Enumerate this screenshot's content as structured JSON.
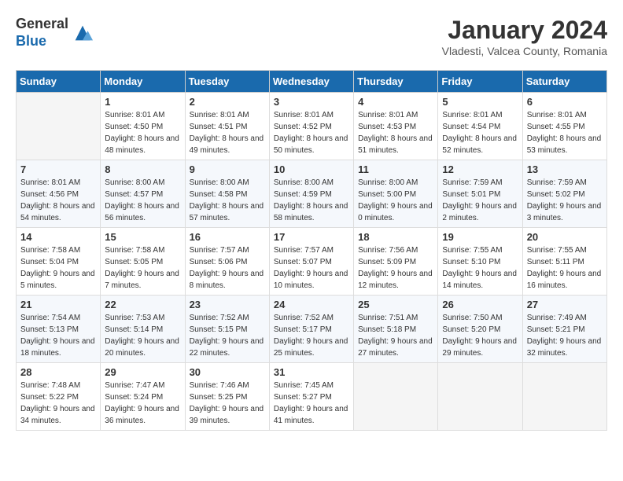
{
  "logo": {
    "general": "General",
    "blue": "Blue"
  },
  "title": "January 2024",
  "location": "Vladesti, Valcea County, Romania",
  "days_of_week": [
    "Sunday",
    "Monday",
    "Tuesday",
    "Wednesday",
    "Thursday",
    "Friday",
    "Saturday"
  ],
  "weeks": [
    [
      {
        "day": "",
        "sunrise": "",
        "sunset": "",
        "daylight": ""
      },
      {
        "day": "1",
        "sunrise": "Sunrise: 8:01 AM",
        "sunset": "Sunset: 4:50 PM",
        "daylight": "Daylight: 8 hours and 48 minutes."
      },
      {
        "day": "2",
        "sunrise": "Sunrise: 8:01 AM",
        "sunset": "Sunset: 4:51 PM",
        "daylight": "Daylight: 8 hours and 49 minutes."
      },
      {
        "day": "3",
        "sunrise": "Sunrise: 8:01 AM",
        "sunset": "Sunset: 4:52 PM",
        "daylight": "Daylight: 8 hours and 50 minutes."
      },
      {
        "day": "4",
        "sunrise": "Sunrise: 8:01 AM",
        "sunset": "Sunset: 4:53 PM",
        "daylight": "Daylight: 8 hours and 51 minutes."
      },
      {
        "day": "5",
        "sunrise": "Sunrise: 8:01 AM",
        "sunset": "Sunset: 4:54 PM",
        "daylight": "Daylight: 8 hours and 52 minutes."
      },
      {
        "day": "6",
        "sunrise": "Sunrise: 8:01 AM",
        "sunset": "Sunset: 4:55 PM",
        "daylight": "Daylight: 8 hours and 53 minutes."
      }
    ],
    [
      {
        "day": "7",
        "sunrise": "Sunrise: 8:01 AM",
        "sunset": "Sunset: 4:56 PM",
        "daylight": "Daylight: 8 hours and 54 minutes."
      },
      {
        "day": "8",
        "sunrise": "Sunrise: 8:00 AM",
        "sunset": "Sunset: 4:57 PM",
        "daylight": "Daylight: 8 hours and 56 minutes."
      },
      {
        "day": "9",
        "sunrise": "Sunrise: 8:00 AM",
        "sunset": "Sunset: 4:58 PM",
        "daylight": "Daylight: 8 hours and 57 minutes."
      },
      {
        "day": "10",
        "sunrise": "Sunrise: 8:00 AM",
        "sunset": "Sunset: 4:59 PM",
        "daylight": "Daylight: 8 hours and 58 minutes."
      },
      {
        "day": "11",
        "sunrise": "Sunrise: 8:00 AM",
        "sunset": "Sunset: 5:00 PM",
        "daylight": "Daylight: 9 hours and 0 minutes."
      },
      {
        "day": "12",
        "sunrise": "Sunrise: 7:59 AM",
        "sunset": "Sunset: 5:01 PM",
        "daylight": "Daylight: 9 hours and 2 minutes."
      },
      {
        "day": "13",
        "sunrise": "Sunrise: 7:59 AM",
        "sunset": "Sunset: 5:02 PM",
        "daylight": "Daylight: 9 hours and 3 minutes."
      }
    ],
    [
      {
        "day": "14",
        "sunrise": "Sunrise: 7:58 AM",
        "sunset": "Sunset: 5:04 PM",
        "daylight": "Daylight: 9 hours and 5 minutes."
      },
      {
        "day": "15",
        "sunrise": "Sunrise: 7:58 AM",
        "sunset": "Sunset: 5:05 PM",
        "daylight": "Daylight: 9 hours and 7 minutes."
      },
      {
        "day": "16",
        "sunrise": "Sunrise: 7:57 AM",
        "sunset": "Sunset: 5:06 PM",
        "daylight": "Daylight: 9 hours and 8 minutes."
      },
      {
        "day": "17",
        "sunrise": "Sunrise: 7:57 AM",
        "sunset": "Sunset: 5:07 PM",
        "daylight": "Daylight: 9 hours and 10 minutes."
      },
      {
        "day": "18",
        "sunrise": "Sunrise: 7:56 AM",
        "sunset": "Sunset: 5:09 PM",
        "daylight": "Daylight: 9 hours and 12 minutes."
      },
      {
        "day": "19",
        "sunrise": "Sunrise: 7:55 AM",
        "sunset": "Sunset: 5:10 PM",
        "daylight": "Daylight: 9 hours and 14 minutes."
      },
      {
        "day": "20",
        "sunrise": "Sunrise: 7:55 AM",
        "sunset": "Sunset: 5:11 PM",
        "daylight": "Daylight: 9 hours and 16 minutes."
      }
    ],
    [
      {
        "day": "21",
        "sunrise": "Sunrise: 7:54 AM",
        "sunset": "Sunset: 5:13 PM",
        "daylight": "Daylight: 9 hours and 18 minutes."
      },
      {
        "day": "22",
        "sunrise": "Sunrise: 7:53 AM",
        "sunset": "Sunset: 5:14 PM",
        "daylight": "Daylight: 9 hours and 20 minutes."
      },
      {
        "day": "23",
        "sunrise": "Sunrise: 7:52 AM",
        "sunset": "Sunset: 5:15 PM",
        "daylight": "Daylight: 9 hours and 22 minutes."
      },
      {
        "day": "24",
        "sunrise": "Sunrise: 7:52 AM",
        "sunset": "Sunset: 5:17 PM",
        "daylight": "Daylight: 9 hours and 25 minutes."
      },
      {
        "day": "25",
        "sunrise": "Sunrise: 7:51 AM",
        "sunset": "Sunset: 5:18 PM",
        "daylight": "Daylight: 9 hours and 27 minutes."
      },
      {
        "day": "26",
        "sunrise": "Sunrise: 7:50 AM",
        "sunset": "Sunset: 5:20 PM",
        "daylight": "Daylight: 9 hours and 29 minutes."
      },
      {
        "day": "27",
        "sunrise": "Sunrise: 7:49 AM",
        "sunset": "Sunset: 5:21 PM",
        "daylight": "Daylight: 9 hours and 32 minutes."
      }
    ],
    [
      {
        "day": "28",
        "sunrise": "Sunrise: 7:48 AM",
        "sunset": "Sunset: 5:22 PM",
        "daylight": "Daylight: 9 hours and 34 minutes."
      },
      {
        "day": "29",
        "sunrise": "Sunrise: 7:47 AM",
        "sunset": "Sunset: 5:24 PM",
        "daylight": "Daylight: 9 hours and 36 minutes."
      },
      {
        "day": "30",
        "sunrise": "Sunrise: 7:46 AM",
        "sunset": "Sunset: 5:25 PM",
        "daylight": "Daylight: 9 hours and 39 minutes."
      },
      {
        "day": "31",
        "sunrise": "Sunrise: 7:45 AM",
        "sunset": "Sunset: 5:27 PM",
        "daylight": "Daylight: 9 hours and 41 minutes."
      },
      {
        "day": "",
        "sunrise": "",
        "sunset": "",
        "daylight": ""
      },
      {
        "day": "",
        "sunrise": "",
        "sunset": "",
        "daylight": ""
      },
      {
        "day": "",
        "sunrise": "",
        "sunset": "",
        "daylight": ""
      }
    ]
  ]
}
